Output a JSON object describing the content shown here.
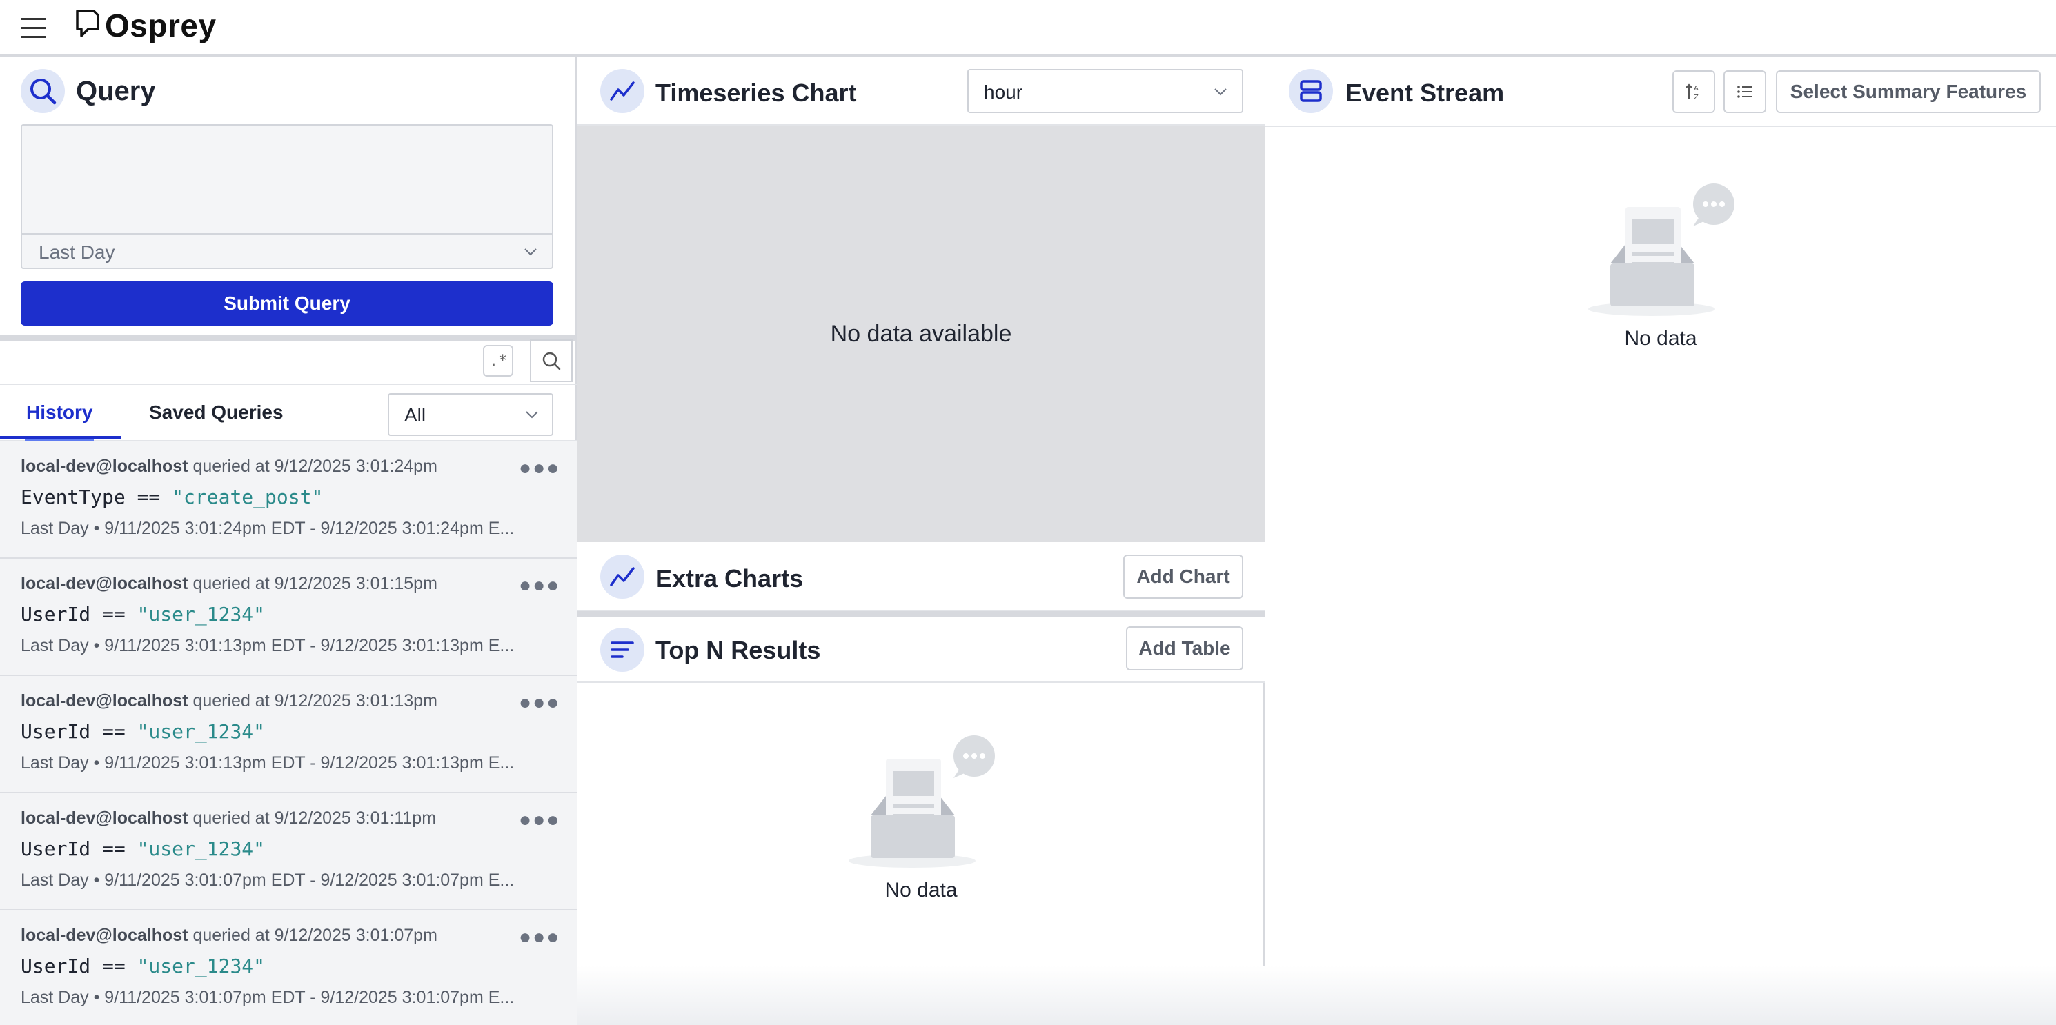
{
  "header": {
    "brand": "Osprey"
  },
  "query": {
    "title": "Query",
    "input_value": "",
    "time_range": "Last Day",
    "submit_label": "Submit Query",
    "regex_toggle": ".*"
  },
  "history_tabs": {
    "tabs": [
      "History",
      "Saved Queries"
    ],
    "active": "History",
    "filter_value": "All"
  },
  "history": [
    {
      "user": "local-dev@localhost",
      "queried_text": " queried at 9/12/2025 3:01:24pm",
      "query_field": "EventType == ",
      "query_value": "\"create_post\"",
      "range": "Last Day • 9/11/2025 3:01:24pm EDT - 9/12/2025 3:01:24pm E..."
    },
    {
      "user": "local-dev@localhost",
      "queried_text": " queried at 9/12/2025 3:01:15pm",
      "query_field": "UserId == ",
      "query_value": "\"user_1234\"",
      "range": "Last Day • 9/11/2025 3:01:13pm EDT - 9/12/2025 3:01:13pm E..."
    },
    {
      "user": "local-dev@localhost",
      "queried_text": " queried at 9/12/2025 3:01:13pm",
      "query_field": "UserId == ",
      "query_value": "\"user_1234\"",
      "range": "Last Day • 9/11/2025 3:01:13pm EDT - 9/12/2025 3:01:13pm E..."
    },
    {
      "user": "local-dev@localhost",
      "queried_text": " queried at 9/12/2025 3:01:11pm",
      "query_field": "UserId == ",
      "query_value": "\"user_1234\"",
      "range": "Last Day • 9/11/2025 3:01:07pm EDT - 9/12/2025 3:01:07pm E..."
    },
    {
      "user": "local-dev@localhost",
      "queried_text": " queried at 9/12/2025 3:01:07pm",
      "query_field": "UserId == ",
      "query_value": "\"user_1234\"",
      "range": "Last Day • 9/11/2025 3:01:07pm EDT - 9/12/2025 3:01:07pm E..."
    }
  ],
  "timeseries": {
    "title": "Timeseries Chart",
    "granularity": "hour",
    "empty_text": "No data available"
  },
  "extra_charts": {
    "title": "Extra Charts",
    "add_label": "Add Chart"
  },
  "top_n": {
    "title": "Top N Results",
    "add_label": "Add Table",
    "empty_text": "No data"
  },
  "event_stream": {
    "title": "Event Stream",
    "summary_label": "Select Summary Features",
    "empty_text": "No data"
  },
  "colors": {
    "accent": "#1d2fcc",
    "icon_bg": "#dfe6f7",
    "string_literal": "#2a8a8a",
    "chart_bg": "#dedfe2"
  },
  "icons": [
    "menu-icon",
    "osprey-logo-icon",
    "search-icon",
    "trend-line-icon",
    "chevron-down-icon",
    "bars-icon",
    "stack-icon",
    "sort-icon",
    "list-icon",
    "more-icon",
    "empty-inbox-icon"
  ]
}
